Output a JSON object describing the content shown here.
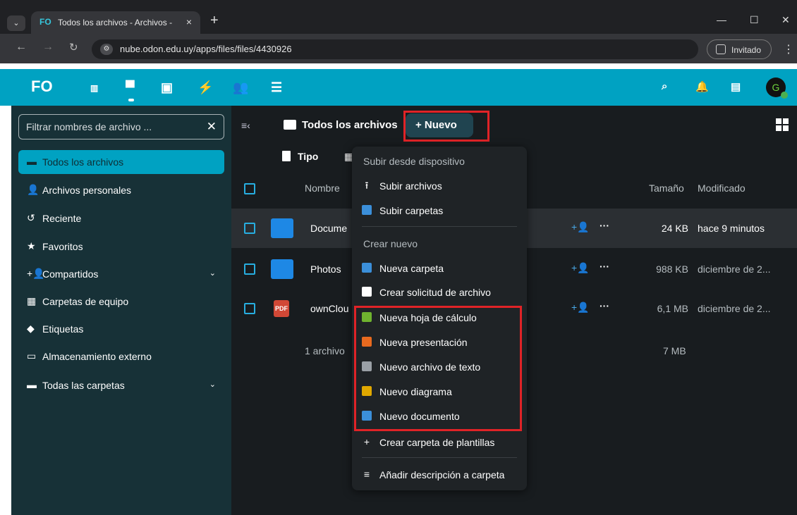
{
  "browser": {
    "tab_title": "Todos los archivos - Archivos - ",
    "tab_favicon": "FO",
    "url": "nube.odon.edu.uy/apps/files/files/4430926",
    "profile_label": "Invitado",
    "new_tab": "+",
    "close_tab": "×",
    "minimize": "—",
    "maximize": "☐",
    "close_window": "✕"
  },
  "header": {
    "logo": "FO",
    "avatar_letter": "G",
    "accent": "#00a2c2"
  },
  "sidebar": {
    "filter_placeholder": "Filtrar nombres de archivo ...",
    "items": [
      {
        "label": "Todos los archivos",
        "icon": "folder-icon"
      },
      {
        "label": "Archivos personales",
        "icon": "user-icon"
      },
      {
        "label": "Reciente",
        "icon": "history-icon"
      },
      {
        "label": "Favoritos",
        "icon": "star-icon"
      },
      {
        "label": "Compartidos",
        "icon": "share-icon"
      },
      {
        "label": "Carpetas de equipo",
        "icon": "group-folder-icon"
      },
      {
        "label": "Etiquetas",
        "icon": "tag-icon"
      },
      {
        "label": "Almacenamiento externo",
        "icon": "external-storage-icon"
      },
      {
        "label": "Todas las carpetas",
        "icon": "folder-icon"
      }
    ]
  },
  "main": {
    "breadcrumb": "Todos los archivos",
    "new_button": "+ Nuevo",
    "filter_type": "Tipo",
    "columns": {
      "name": "Nombre",
      "size": "Tamaño",
      "modified": "Modificado"
    },
    "files": [
      {
        "name": "Docume",
        "size": "24 KB",
        "modified": "hace 9 minutos",
        "type": "folder"
      },
      {
        "name": "Photos",
        "size": "988 KB",
        "modified": "diciembre de 2...",
        "type": "folder"
      },
      {
        "name": "ownClou",
        "size": "6,1 MB",
        "modified": "diciembre de 2...",
        "type": "pdf",
        "badge": "PDF"
      }
    ],
    "summary": {
      "count": "1 archivo",
      "total": "7 MB"
    }
  },
  "new_menu": {
    "upload_header": "Subir desde dispositivo",
    "upload_files": "Subir archivos",
    "upload_folders": "Subir carpetas",
    "create_header": "Crear nuevo",
    "new_folder": "Nueva carpeta",
    "file_request": "Crear solicitud de archivo",
    "spreadsheet": "Nueva hoja de cálculo",
    "presentation": "Nueva presentación",
    "text_file": "Nuevo archivo de texto",
    "diagram": "Nuevo diagrama",
    "document": "Nuevo documento",
    "templates": "Crear carpeta de plantillas",
    "description": "Añadir descripción a carpeta"
  }
}
